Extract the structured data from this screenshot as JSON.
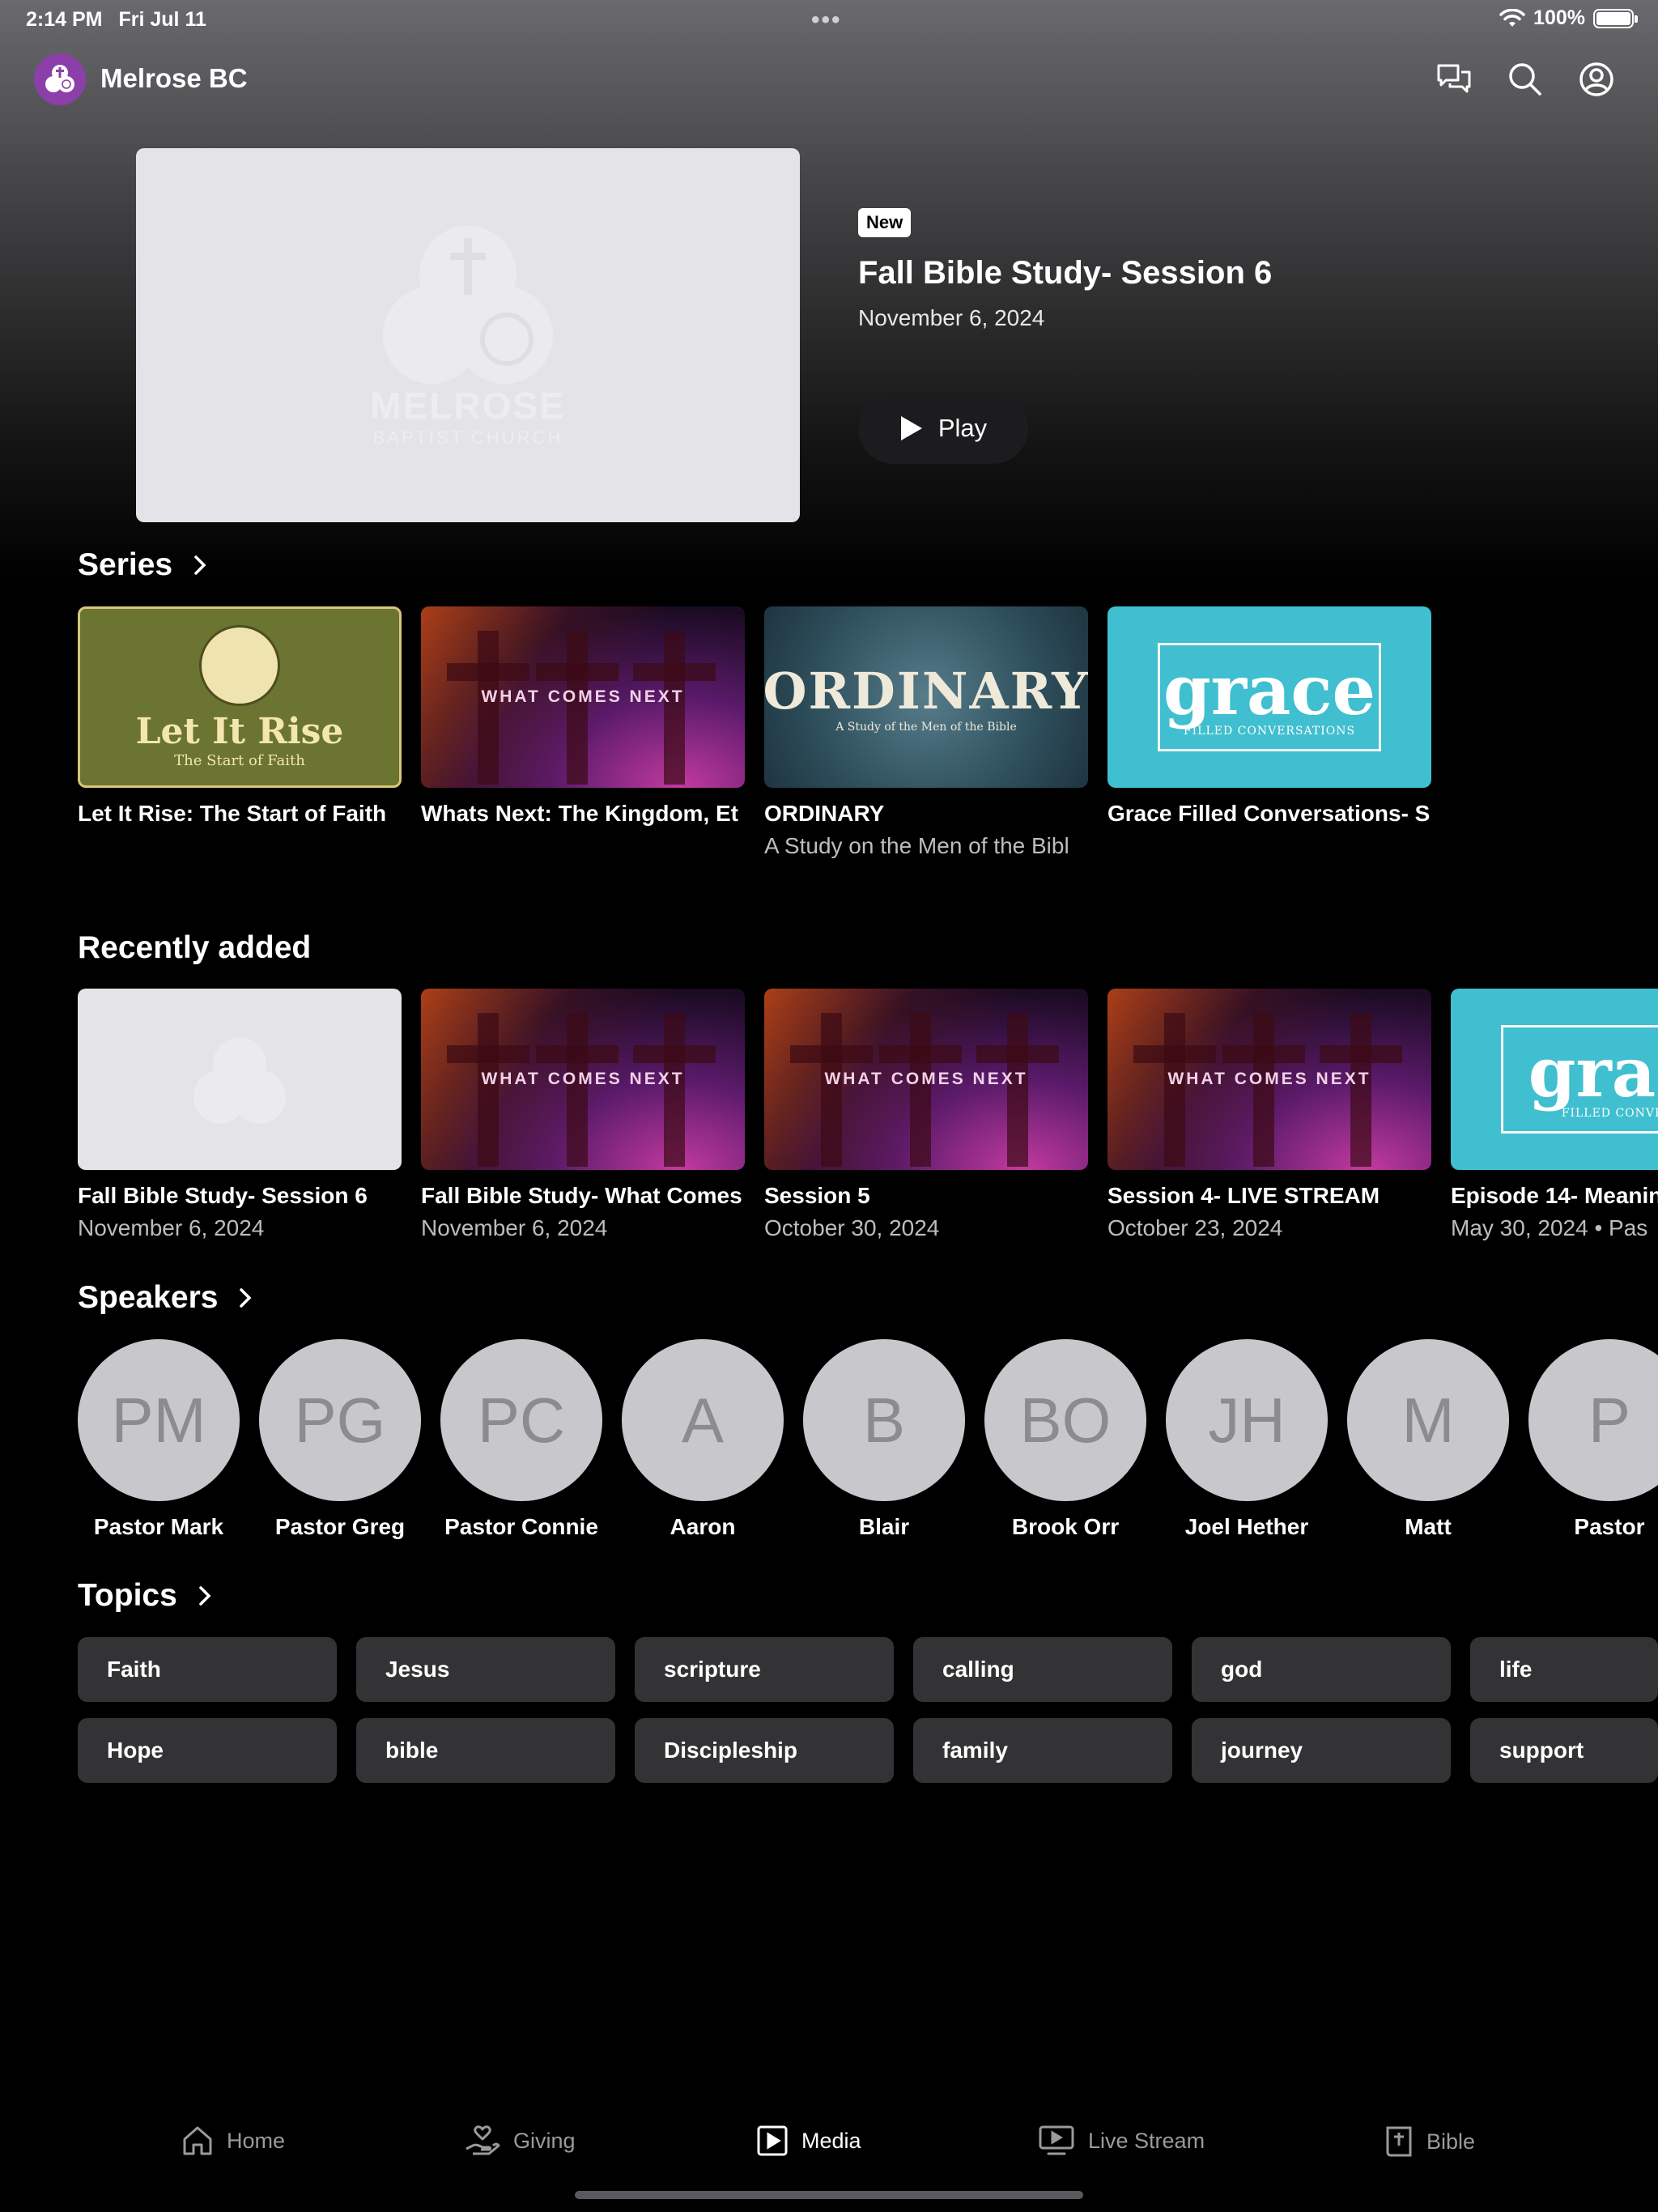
{
  "status_bar": {
    "time": "2:14 PM",
    "date": "Fri Jul 11",
    "battery": "100%",
    "battery_level": 1.0
  },
  "header": {
    "title": "Melrose BC",
    "icons": [
      "chat-icon",
      "search-icon",
      "profile-icon"
    ]
  },
  "hero": {
    "image_text": "MELROSE",
    "image_subtext": "BAPTIST CHURCH",
    "badge": "New",
    "title": "Fall Bible Study- Session 6",
    "date": "November 6, 2024",
    "play_label": "Play"
  },
  "series": {
    "title": "Series",
    "items": [
      {
        "title": "Let It Rise: The Start of Faith",
        "art": "let-it-rise",
        "art_title": "Let It Rise",
        "art_sub": "The Start of Faith"
      },
      {
        "title": "Whats Next: The Kingdom, Et",
        "art": "what-comes-next",
        "art_title": "WHAT COMES NEXT"
      },
      {
        "title": "ORDINARY",
        "subtitle": "A Study on the Men of the Bibl",
        "art": "ordinary",
        "art_title": "ORDINARY",
        "art_sub": "A Study of the Men of the Bible"
      },
      {
        "title": "Grace Filled Conversations- S",
        "art": "grace",
        "art_title": "grace",
        "art_sub": "FILLED CONVERSATIONS"
      }
    ]
  },
  "recently_added": {
    "title": "Recently added",
    "items": [
      {
        "title": "Fall Bible Study- Session 6",
        "date": "November 6, 2024",
        "art": "melrose"
      },
      {
        "title": "Fall Bible Study- What Comes",
        "date": "November 6, 2024",
        "art": "what-comes-next",
        "art_title": "WHAT COMES NEXT"
      },
      {
        "title": "Session 5",
        "date": "October 30, 2024",
        "art": "what-comes-next",
        "art_title": "WHAT COMES NEXT"
      },
      {
        "title": "Session 4- LIVE STREAM",
        "date": "October 23, 2024",
        "art": "what-comes-next",
        "art_title": "WHAT COMES NEXT"
      },
      {
        "title": "Episode 14- Meanin",
        "date": "May 30, 2024 • Pas",
        "art": "grace",
        "art_title": "grac",
        "art_sub": "FILLED CONVE"
      }
    ]
  },
  "speakers": {
    "title": "Speakers",
    "items": [
      {
        "initials": "PM",
        "name": "Pastor Mark"
      },
      {
        "initials": "PG",
        "name": "Pastor Greg"
      },
      {
        "initials": "PC",
        "name": "Pastor Connie"
      },
      {
        "initials": "A",
        "name": "Aaron"
      },
      {
        "initials": "B",
        "name": "Blair"
      },
      {
        "initials": "BO",
        "name": "Brook Orr"
      },
      {
        "initials": "JH",
        "name": "Joel Hether"
      },
      {
        "initials": "M",
        "name": "Matt"
      },
      {
        "initials": "P",
        "name": "Pastor"
      }
    ]
  },
  "topics": {
    "title": "Topics",
    "row1": [
      "Faith",
      "Jesus",
      "scripture",
      "calling",
      "god",
      "life"
    ],
    "row2": [
      "Hope",
      "bible",
      "Discipleship",
      "family",
      "journey",
      "support"
    ]
  },
  "tab_bar": {
    "items": [
      {
        "label": "Home",
        "icon": "home-icon",
        "active": false
      },
      {
        "label": "Giving",
        "icon": "giving-icon",
        "active": false
      },
      {
        "label": "Media",
        "icon": "media-icon",
        "active": true
      },
      {
        "label": "Live Stream",
        "icon": "live-stream-icon",
        "active": false
      },
      {
        "label": "Bible",
        "icon": "bible-icon",
        "active": false
      }
    ]
  },
  "colors": {
    "background": "#000000",
    "logo": "#8c3fa8",
    "chip": "#333335",
    "avatar": "#c8c8cc",
    "grace": "#3fbfcf"
  }
}
